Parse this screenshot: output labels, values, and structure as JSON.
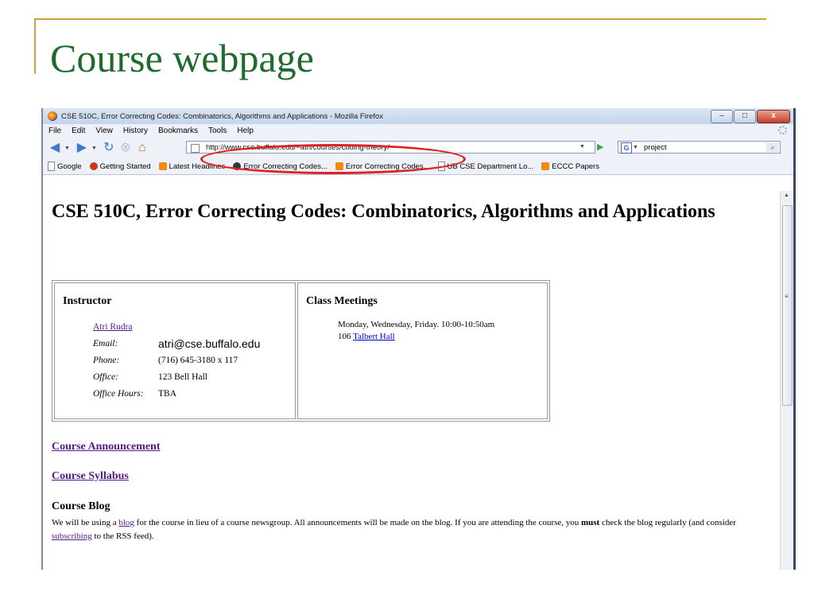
{
  "slide": {
    "title": "Course webpage"
  },
  "window": {
    "title": "CSE 510C, Error Correcting Codes: Combinatorics, Algorithms and Applications - Mozilla Firefox",
    "controls": {
      "minimize": "–",
      "maximize": "□",
      "close": "x"
    }
  },
  "menubar": {
    "items": [
      "File",
      "Edit",
      "View",
      "History",
      "Bookmarks",
      "Tools",
      "Help"
    ]
  },
  "navbar": {
    "url": "http://www.cse.buffalo.edu/~atri/courses/coding-theory/",
    "search_engine": "G",
    "search_value": "project"
  },
  "bookmarks": [
    {
      "label": "Google",
      "icon": "page-icon"
    },
    {
      "label": "Getting Started",
      "icon": "flower-icon"
    },
    {
      "label": "Latest Headlines",
      "icon": "rss-icon"
    },
    {
      "label": "Error Correcting Codes...",
      "icon": "wordpress-icon"
    },
    {
      "label": "Error Correcting Codes...",
      "icon": "rss-icon"
    },
    {
      "label": "UB CSE Department Lo...",
      "icon": "page-icon"
    },
    {
      "label": "ECCC Papers",
      "icon": "rss-icon"
    }
  ],
  "page": {
    "heading": "CSE 510C, Error Correcting Codes: Combinatorics, Algorithms and Applications",
    "instructor": {
      "header": "Instructor",
      "name": "Atri Rudra",
      "email_label": "Email:",
      "email": "atri@cse.buffalo.edu",
      "phone_label": "Phone:",
      "phone": "(716) 645-3180 x 117",
      "office_label": "Office:",
      "office": "123 Bell Hall",
      "hours_label": "Office Hours:",
      "hours": "TBA"
    },
    "class_meetings": {
      "header": "Class Meetings",
      "schedule": "Monday, Wednesday, Friday. 10:00-10:50am",
      "room_number": "106",
      "room_building": "Talbert Hall"
    },
    "links": {
      "announcement": "Course Announcement",
      "syllabus": "Course Syllabus"
    },
    "blog": {
      "heading": "Course Blog",
      "text_1": "We will be using a ",
      "blog_link": "blog",
      "text_2": " for the course in lieu of a course newsgroup. All announcements will be made on the blog. If you are attending the course, you ",
      "must": "must",
      "text_3": " check the blog regularly (and consider ",
      "subscribe_link": "subscribing",
      "text_4": " to the RSS feed)."
    }
  },
  "colors": {
    "title_green": "#1e6b2c",
    "rule_gold": "#c9a438",
    "annotation_red": "#e02020"
  }
}
